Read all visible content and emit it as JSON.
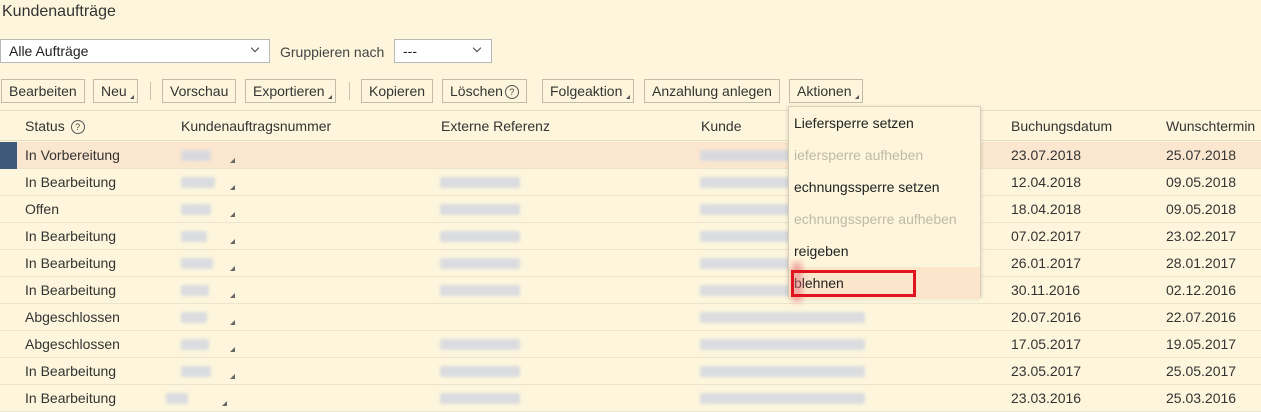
{
  "page": {
    "title": "Kundenaufträge"
  },
  "filter": {
    "view_value": "Alle Aufträge",
    "group_label": "Gruppieren nach",
    "group_value": "---"
  },
  "toolbar": {
    "edit": "Bearbeiten",
    "new": "Neu",
    "preview": "Vorschau",
    "export": "Exportieren",
    "copy": "Kopieren",
    "delete": "Löschen",
    "followup": "Folgeaktion",
    "deposit": "Anzahlung anlegen",
    "actions": "Aktionen"
  },
  "table": {
    "columns": {
      "status": "Status",
      "order_no": "Kundenauftragsnummer",
      "ext_ref": "Externe Referenz",
      "customer": "Kunde",
      "booking_date": "Buchungsdatum",
      "desired_date": "Wunschtermin"
    },
    "rows": [
      {
        "status": "In Vorbereitung",
        "booking_date": "23.07.2018",
        "desired_date": "25.07.2018"
      },
      {
        "status": "In Bearbeitung",
        "booking_date": "12.04.2018",
        "desired_date": "09.05.2018"
      },
      {
        "status": "Offen",
        "booking_date": "18.04.2018",
        "desired_date": "09.05.2018"
      },
      {
        "status": "In Bearbeitung",
        "booking_date": "07.02.2017",
        "desired_date": "23.02.2017"
      },
      {
        "status": "In Bearbeitung",
        "booking_date": "26.01.2017",
        "desired_date": "28.01.2017"
      },
      {
        "status": "In Bearbeitung",
        "booking_date": "30.11.2016",
        "desired_date": "02.12.2016"
      },
      {
        "status": "Abgeschlossen",
        "booking_date": "20.07.2016",
        "desired_date": "22.07.2016"
      },
      {
        "status": "Abgeschlossen",
        "booking_date": "17.05.2017",
        "desired_date": "19.05.2017"
      },
      {
        "status": "In Bearbeitung",
        "booking_date": "23.05.2017",
        "desired_date": "25.05.2017"
      },
      {
        "status": "In Bearbeitung",
        "booking_date": "23.03.2016",
        "desired_date": "25.03.2016"
      }
    ]
  },
  "actions_menu": {
    "items": [
      {
        "label": "Liefersperre setzen",
        "disabled": false
      },
      {
        "label": "iefersperre aufheben",
        "disabled": true
      },
      {
        "label": "echnungssperre setzen",
        "disabled": false
      },
      {
        "label": "echnungssperre aufheben",
        "disabled": true
      },
      {
        "label": "reigeben",
        "disabled": false
      },
      {
        "label": "blehnen",
        "disabled": false
      }
    ]
  },
  "colors": {
    "background": "#fdf6dc",
    "selected_row": "#fbe7cf",
    "row_marker": "#3d5a7a",
    "highlight_box": "#e0141e"
  }
}
